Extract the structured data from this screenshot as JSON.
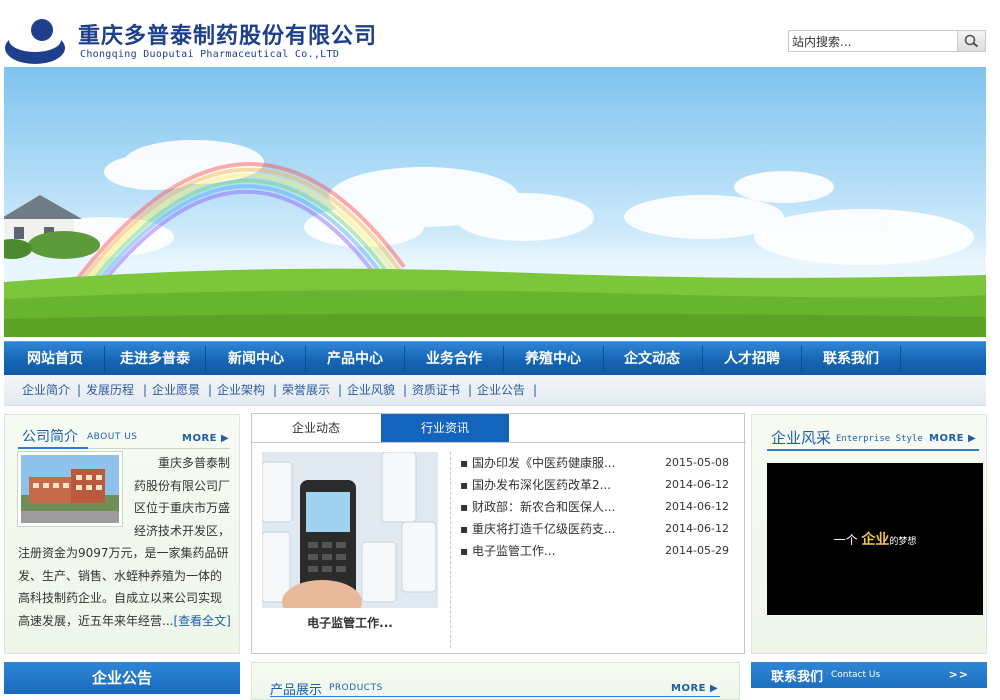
{
  "header": {
    "company_cn": "重庆多普泰制药股份有限公司",
    "company_en": "Chongqing Duoputai Pharmaceutical Co.,LTD",
    "search_placeholder": "站内搜索..."
  },
  "nav": {
    "items": [
      "网站首页",
      "走进多普泰",
      "新闻中心",
      "产品中心",
      "业务合作",
      "养殖中心",
      "企文动态",
      "人才招聘",
      "联系我们"
    ]
  },
  "subnav": {
    "items": [
      "企业简介",
      "发展历程",
      "企业愿景",
      "企业架构",
      "荣誉展示",
      "企业风貌",
      "资质证书",
      "企业公告"
    ]
  },
  "about": {
    "title": "公司简介",
    "subtitle": "ABOUT US",
    "more": "MORE",
    "text_lines": [
      "重庆多普泰制",
      "药股份有限公司厂",
      "区位于重庆市万盛",
      "经济技术开发区，"
    ],
    "text_rest": "注册资金为9097万元，是一家集药品研发、生产、销售、水蛭种养殖为一体的高科技制药企业。自成立以来公司实现高速发展，近五年来年经营...",
    "read_more": "[查看全文]"
  },
  "news": {
    "tabs": [
      "企业动态",
      "行业资讯"
    ],
    "photo_caption": "电子监管工作...",
    "items": [
      {
        "title": "国办印发《中医药健康服...",
        "date": "2015-05-08"
      },
      {
        "title": "国办发布深化医药改革2...",
        "date": "2014-06-12"
      },
      {
        "title": "财政部：新农合和医保人...",
        "date": "2014-06-12"
      },
      {
        "title": "重庆将打造千亿级医药支...",
        "date": "2014-06-12"
      },
      {
        "title": "电子监管工作...",
        "date": "2014-05-29"
      }
    ]
  },
  "style": {
    "title": "企业风采",
    "subtitle": "Enterprise Style",
    "more": "MORE",
    "video_prefix": "一个",
    "video_highlight": "企业",
    "video_suffix": "的梦想"
  },
  "bottom": {
    "notice_title": "企业公告",
    "products_title": "产品展示",
    "products_subtitle": "PRODUCTS",
    "products_more": "MORE",
    "contact_title": "联系我们",
    "contact_subtitle": "Contact Us",
    "contact_arrow": ">>"
  },
  "colors": {
    "brand_blue": "#1d3f8c",
    "nav_blue": "#1765b5",
    "link_blue": "#1d5faa"
  }
}
